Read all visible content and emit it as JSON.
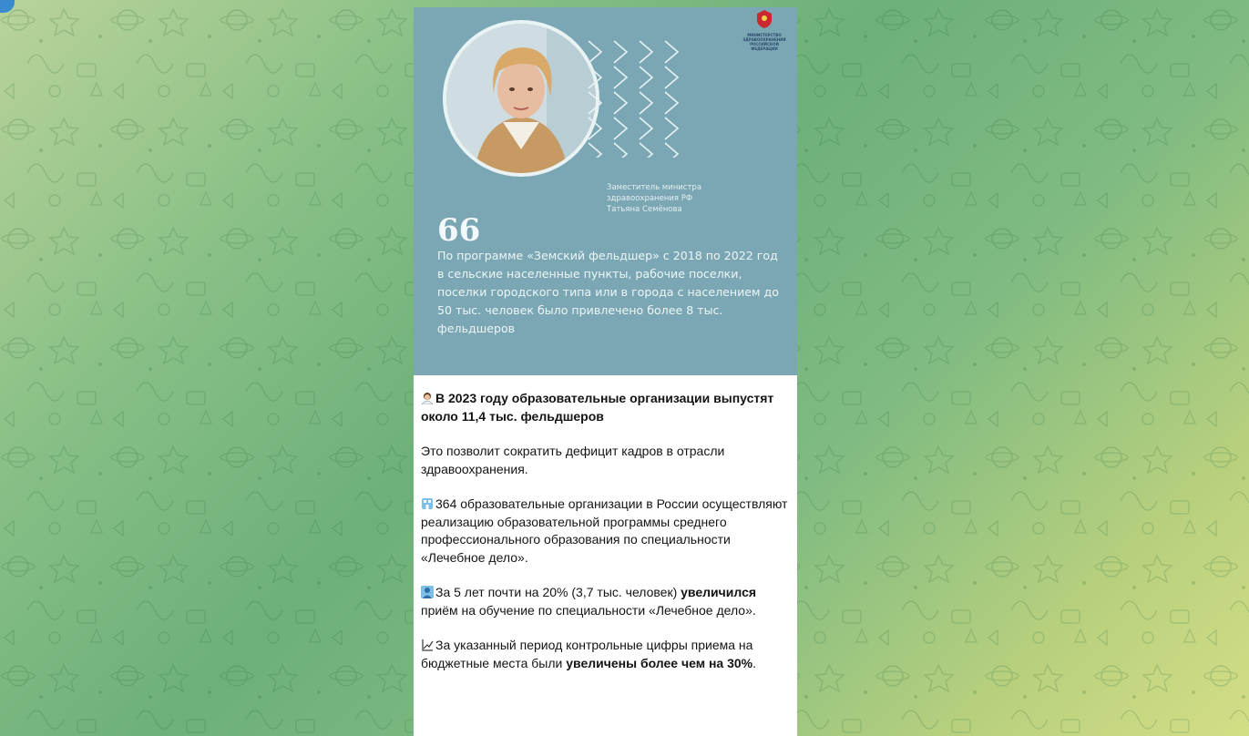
{
  "post": {
    "image": {
      "caption_line1": "Заместитель министра",
      "caption_line2": "здравоохранения РФ",
      "caption_line3": "Татьяна Семёнова",
      "quote_mark": "66",
      "quote": "По программе «Земский фельдшер» с 2018 по 2022 год в сельские населенные пункты, рабочие поселки, поселки городского типа или в города с населением до 50 тыс. человек было привлечено более 8 тыс. фельдшеров",
      "logo_text_1": "МИНИСТЕРСТВО",
      "logo_text_2": "ЗДРАВООХРАНЕНИЯ",
      "logo_text_3": "РОССИЙСКОЙ ФЕДЕРАЦИИ"
    },
    "headline": "В 2023 году образовательные организации выпустят около 11,4 тыс. фельдшеров",
    "p1": "Это позволит сократить дефицит кадров в отрасли здравоохранения.",
    "p2": "364 образовательные организации в России осуществляют реализацию образовательной программы среднего профессионального образования по специальности «Лечебное дело».",
    "p3_start": "За 5 лет почти на 20% (3,7 тыс. человек) ",
    "p3_bold": "увеличился",
    "p3_end": " приём на обучение по специальности «Лечебное дело».",
    "p4_start": "За указанный период контрольные цифры приема на бюджетные места были ",
    "p4_bold": "увеличены более чем на 30%",
    "p4_end": ".",
    "icons": {
      "headline": "health-worker-icon",
      "p2": "hospital-icon",
      "p3": "doctor-icon",
      "p4": "chart-increasing-icon"
    }
  },
  "colors": {
    "hero_bg": "#7ba7b4",
    "text": "#141414"
  }
}
